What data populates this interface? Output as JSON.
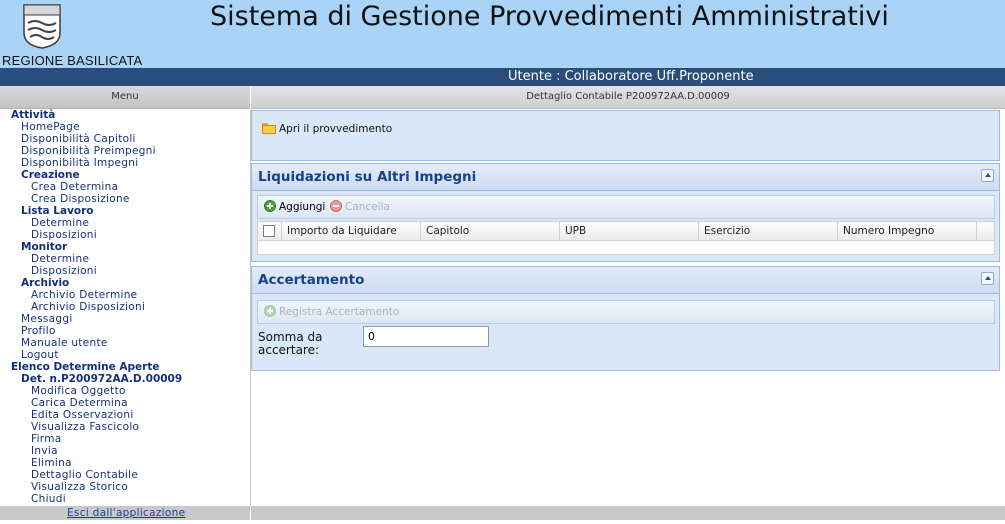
{
  "header": {
    "title": "Sistema di Gestione Provvedimenti Amministrativi",
    "region": "REGIONE BASILICATA",
    "user": "Utente : Collaboratore Uff.Proponente"
  },
  "menu": {
    "header": "Menu",
    "items": [
      {
        "label": "Attività"
      },
      {
        "label": "HomePage"
      },
      {
        "label": "Disponibilità Capitoli"
      },
      {
        "label": "Disponibilità Preimpegni"
      },
      {
        "label": "Disponibilità Impegni"
      },
      {
        "label": "Creazione"
      },
      {
        "label": "Crea Determina"
      },
      {
        "label": "Crea Disposizione"
      },
      {
        "label": "Lista Lavoro"
      },
      {
        "label": "Determine"
      },
      {
        "label": "Disposizioni"
      },
      {
        "label": "Monitor"
      },
      {
        "label": "Determine"
      },
      {
        "label": "Disposizioni"
      },
      {
        "label": "Archivio"
      },
      {
        "label": "Archivio Determine"
      },
      {
        "label": "Archivio Disposizioni"
      },
      {
        "label": "Messaggi"
      },
      {
        "label": "Profilo"
      },
      {
        "label": "Manuale utente"
      },
      {
        "label": "Logout"
      },
      {
        "label": "Elenco Determine Aperte"
      },
      {
        "label": "Det. n.P200972AA.D.00009"
      },
      {
        "label": "Modifica Oggetto"
      },
      {
        "label": "Carica Determina"
      },
      {
        "label": "Edita Osservazioni"
      },
      {
        "label": "Visualizza Fascicolo"
      },
      {
        "label": "Firma"
      },
      {
        "label": "Invia"
      },
      {
        "label": "Elimina"
      },
      {
        "label": "Dettaglio Contabile"
      },
      {
        "label": "Visualizza Storico"
      },
      {
        "label": "Chiudi"
      }
    ],
    "exit": "Esci dall'applicazione"
  },
  "content": {
    "header": "Dettaglio Contabile P200972AA.D.00009",
    "open_link": "Apri il provvedimento",
    "liquidazioni": {
      "title": "Liquidazioni su Altri Impegni",
      "add": "Aggiungi",
      "delete": "Cancella",
      "columns": [
        "Importo da Liquidare",
        "Capitolo",
        "UPB",
        "Esercizio",
        "Numero Impegno"
      ]
    },
    "accertamento": {
      "title": "Accertamento",
      "register": "Registra Accertamento",
      "field_label": "Somma da accertare:",
      "field_value": "0"
    }
  },
  "colors": {
    "header_bg": "#a9d4f7",
    "user_bar": "#2a4e7c",
    "panel_title": "#15428b",
    "panel_bg": "#dae7f6"
  }
}
